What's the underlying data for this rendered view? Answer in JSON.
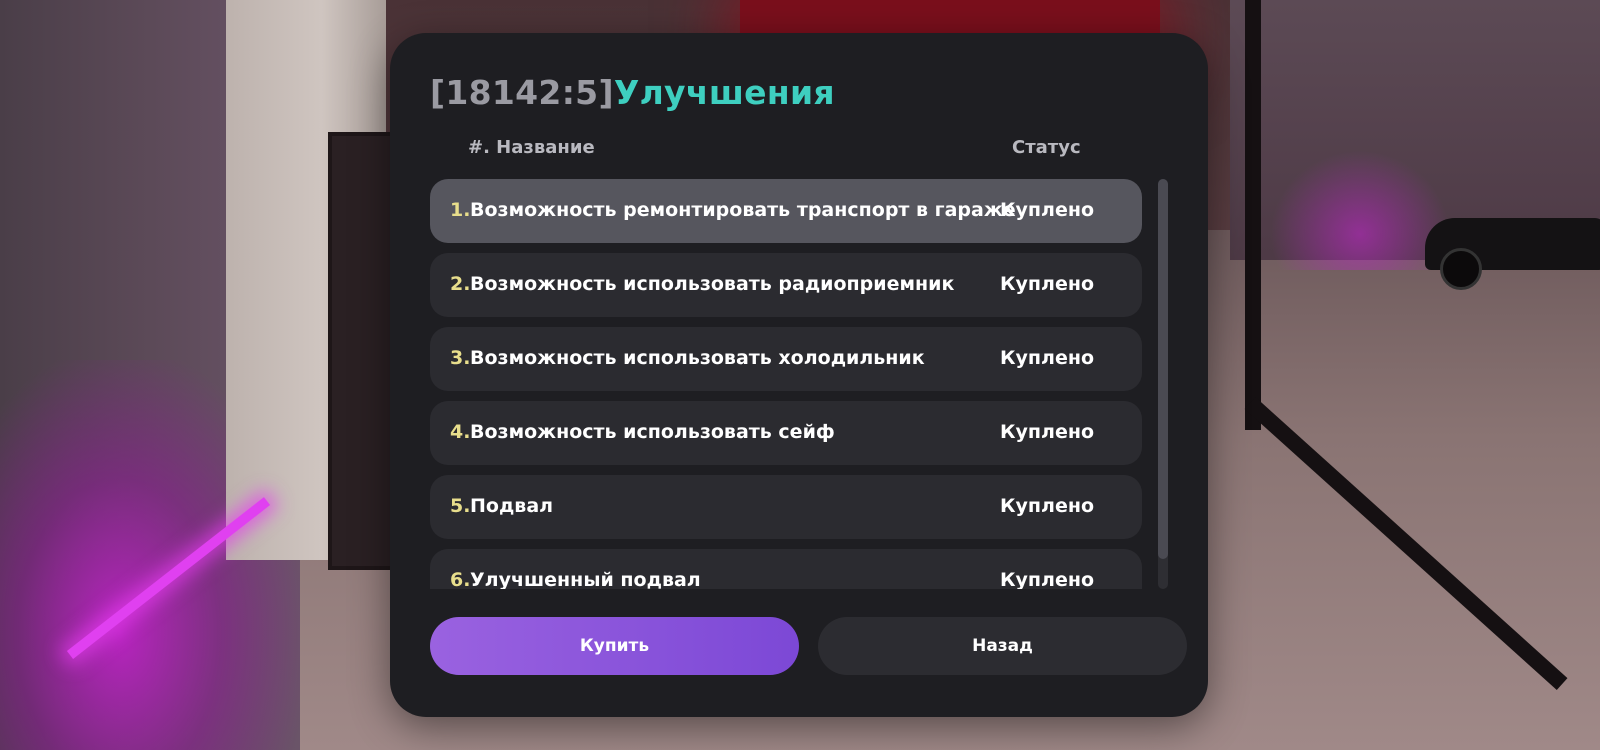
{
  "dialog": {
    "title_id": "[18142:5]",
    "title_name": "Улучшения",
    "columns": {
      "name": "#. Название",
      "status": "Статус"
    },
    "items": [
      {
        "num": "1.",
        "title": "Возможность ремонтировать транспорт в гараже",
        "status": "Куплено",
        "selected": true
      },
      {
        "num": "2.",
        "title": "Возможность использовать радиоприемник",
        "status": "Куплено",
        "selected": false
      },
      {
        "num": "3.",
        "title": "Возможность использовать холодильник",
        "status": "Куплено",
        "selected": false
      },
      {
        "num": "4.",
        "title": "Возможность использовать сейф",
        "status": "Куплено",
        "selected": false
      },
      {
        "num": "5.",
        "title": "Подвал",
        "status": "Куплено",
        "selected": false
      },
      {
        "num": "6.",
        "title": "Улучшенный подвал",
        "status": "Куплено",
        "selected": false
      }
    ],
    "buttons": {
      "buy": "Купить",
      "back": "Назад"
    }
  },
  "colors": {
    "accent_title": "#3ecfc0",
    "number": "#e8de8c",
    "buy_button": "#8a55dc"
  }
}
